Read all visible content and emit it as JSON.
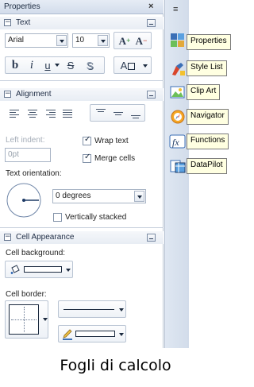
{
  "panel": {
    "title": "Properties",
    "close_glyph": "×"
  },
  "text_section": {
    "title": "Text",
    "font_name": "Arial",
    "font_size": "10",
    "bold_glyph": "b",
    "italic_glyph": "i",
    "underline_glyph": "u",
    "strikethrough_glyph": "S",
    "shadow_glyph": "S",
    "grow_glyph": "A",
    "shrink_glyph": "A",
    "font_color_glyph": "A"
  },
  "alignment_section": {
    "title": "Alignment",
    "left_indent_label": "Left indent:",
    "left_indent_value": "0pt",
    "wrap_text_label": "Wrap text",
    "wrap_text_checked": true,
    "merge_cells_label": "Merge cells",
    "merge_cells_checked": true,
    "orientation_label": "Text orientation:",
    "orientation_value": "0 degrees",
    "vertically_stacked_label": "Vertically stacked",
    "vertically_stacked_checked": false
  },
  "cell_appearance_section": {
    "title": "Cell Appearance",
    "background_label": "Cell background:",
    "border_label": "Cell border:"
  },
  "deck_tabs": [
    {
      "label": "Properties",
      "icon": "properties-icon"
    },
    {
      "label": "Style List",
      "icon": "style-list-icon"
    },
    {
      "label": "Clip Art",
      "icon": "clip-art-icon"
    },
    {
      "label": "Navigator",
      "icon": "navigator-icon"
    },
    {
      "label": "Functions",
      "icon": "functions-icon"
    },
    {
      "label": "DataPilot",
      "icon": "datapilot-icon"
    }
  ],
  "caption": "Fogli di calcolo",
  "colors": {
    "titlebar": "#d2dceb",
    "accent": "#3b6fb6",
    "tooltip_bg": "#ffffe1"
  }
}
